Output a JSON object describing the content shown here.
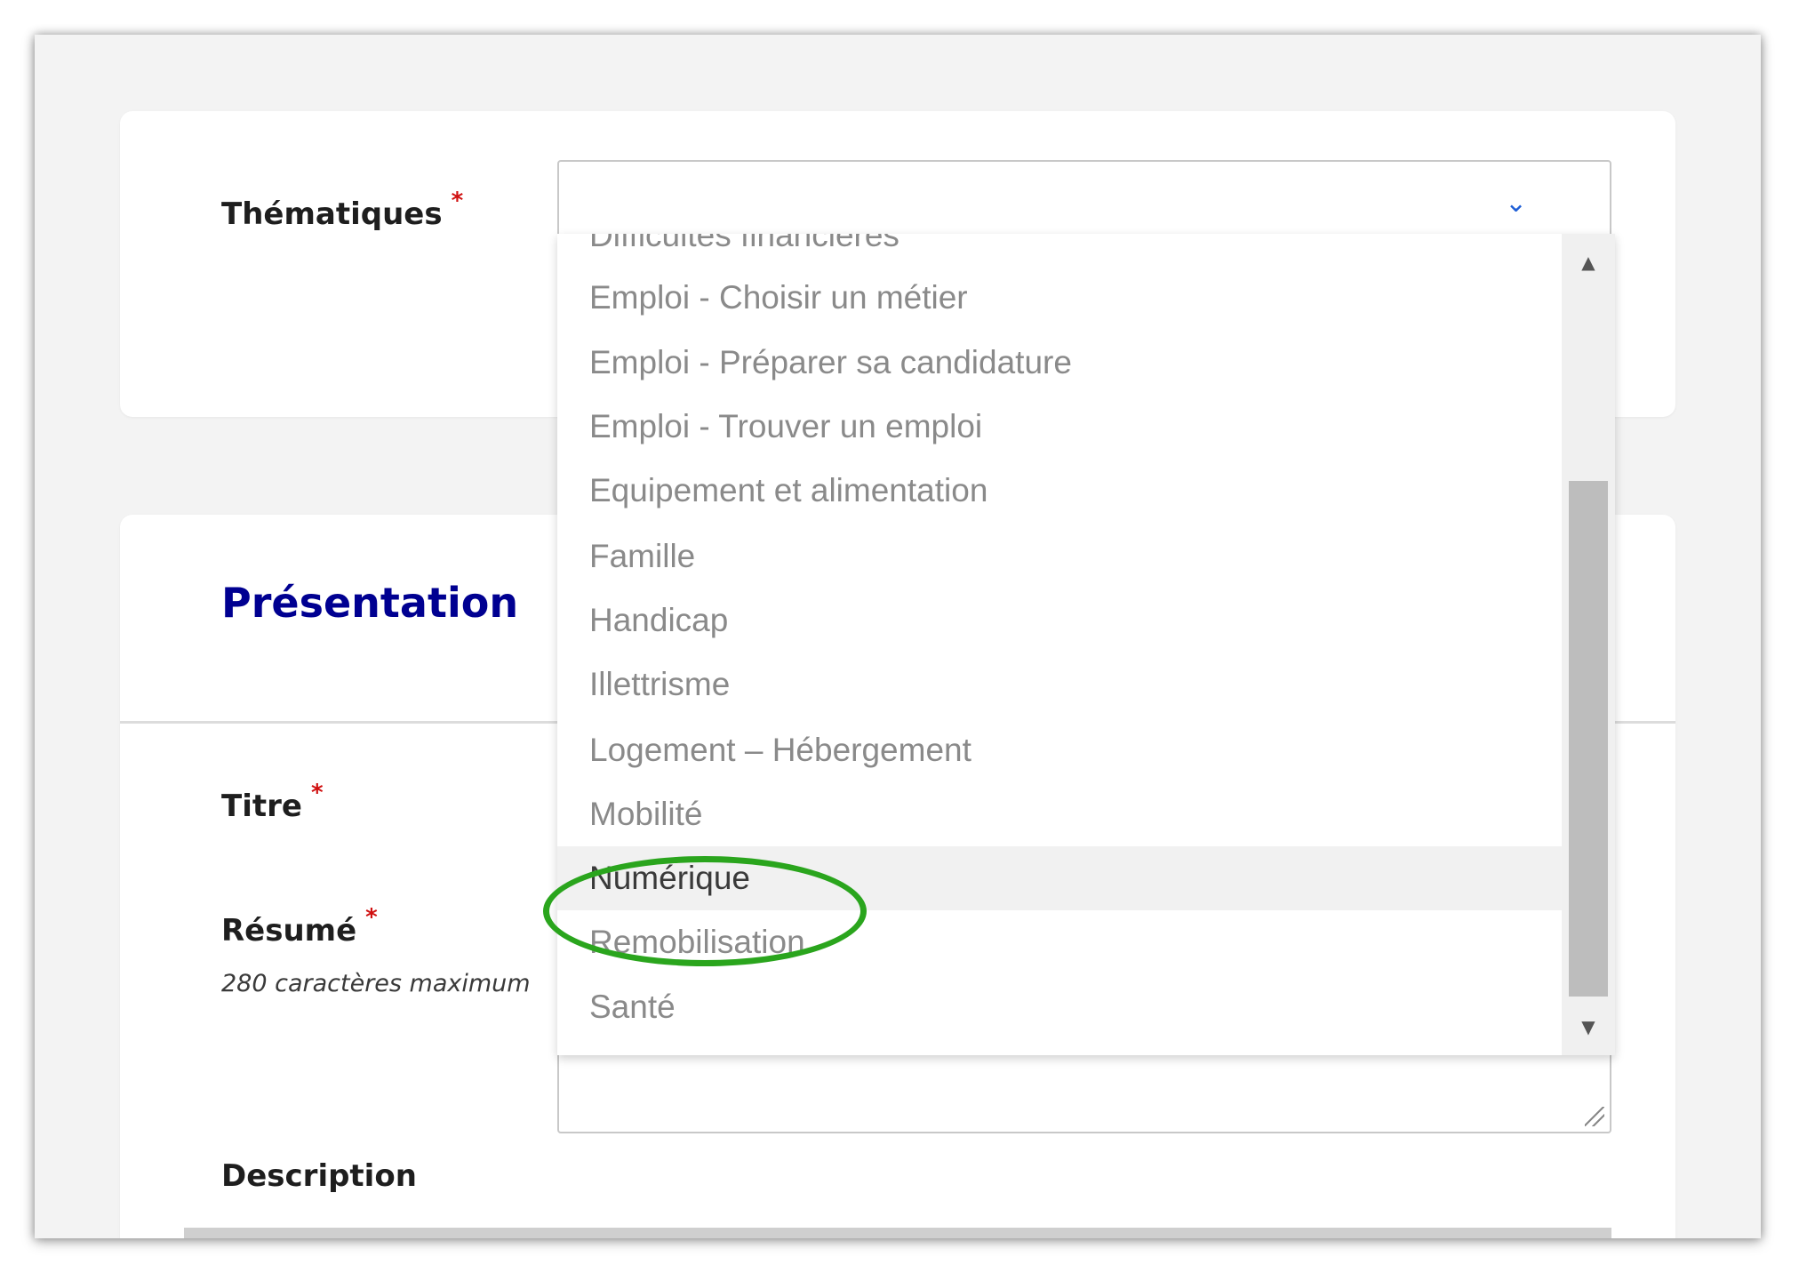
{
  "form": {
    "thematiques": {
      "label": "Thématiques",
      "required": "*"
    },
    "presentation_title": "Présentation",
    "titre": {
      "label": "Titre",
      "required": "*"
    },
    "resume": {
      "label": "Résumé",
      "required": "*",
      "hint": "280 caractères maximum"
    },
    "description": {
      "label": "Description"
    }
  },
  "dropdown": {
    "options": [
      "Difficultés financières",
      "Emploi - Choisir un métier",
      "Emploi - Préparer sa candidature",
      "Emploi - Trouver un emploi",
      "Equipement et alimentation",
      "Famille",
      "Handicap",
      "Illettrisme",
      "Logement – Hébergement",
      "Mobilité",
      "Numérique",
      "Remobilisation",
      "Santé"
    ],
    "highlighted": "Numérique"
  },
  "icons": {
    "chevron": "chevron-down-icon",
    "scroll_up": "scroll-up-arrow-icon",
    "scroll_down": "scroll-down-arrow-icon",
    "resize": "resize-handle-icon"
  },
  "colors": {
    "accent": "#000091",
    "required": "#d01010",
    "annotation": "#2aa51d",
    "chevron": "#1f5fd6"
  }
}
